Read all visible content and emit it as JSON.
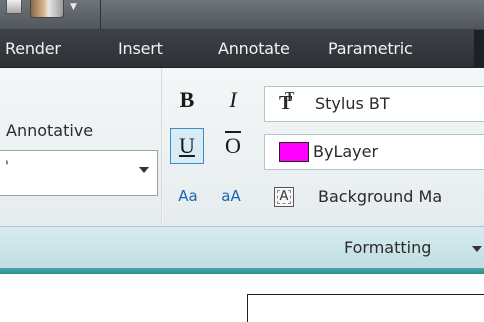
{
  "ribbon": {
    "tabs": [
      {
        "label": "Render"
      },
      {
        "label": "Insert"
      },
      {
        "label": "Annotate"
      },
      {
        "label": "Parametric"
      }
    ]
  },
  "left_panel": {
    "label": "Annotative",
    "style_value": "'"
  },
  "formatting": {
    "bold": "B",
    "italic": "I",
    "underline": "U",
    "overline": "O",
    "case_upper": "Aa",
    "case_lower": "aA",
    "font_icon": "T",
    "font_name": "Stylus BT",
    "color_name": "ByLayer",
    "color_swatch": "#ff00ff",
    "background_mask": "Background Ma",
    "bgmask_icon": "A",
    "panel_title": "Formatting"
  },
  "colors": {
    "tab_bar": "#2c3035",
    "panel_footer": "#c0dde2",
    "accent": "#2f8e92"
  },
  "icons": {
    "quick_access": [
      "arrow-icon",
      "paintbrush-icon",
      "dropdown-icon"
    ]
  }
}
